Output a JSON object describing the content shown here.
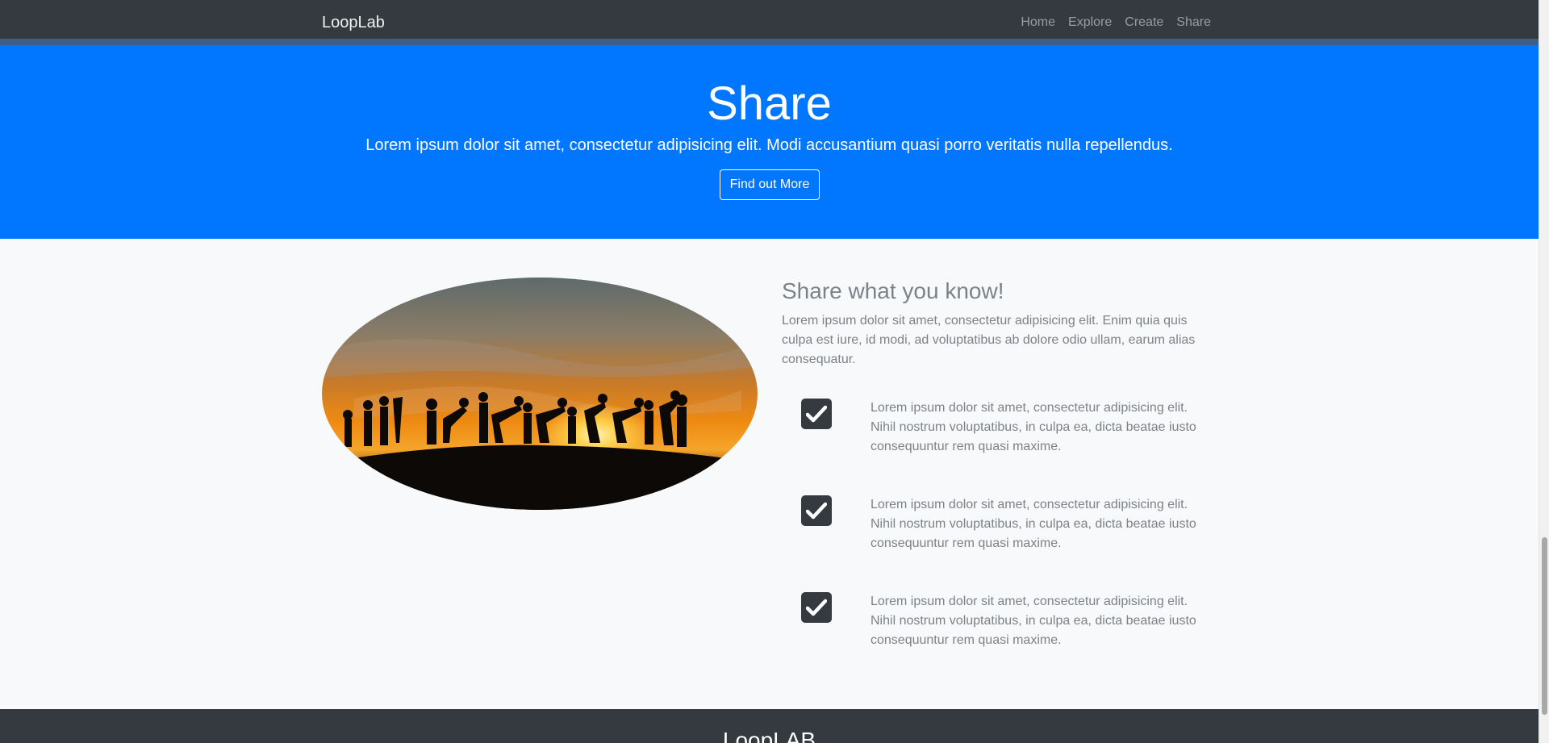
{
  "navbar": {
    "brand": "LoopLab",
    "links": [
      "Home",
      "Explore",
      "Create",
      "Share"
    ]
  },
  "hero": {
    "title": "Share",
    "subtitle": "Lorem ipsum dolor sit amet, consectetur adipisicing elit. Modi accusantium quasi porro veritatis nulla repellendus.",
    "button": "Find out More"
  },
  "section": {
    "title": "Share what you know!",
    "text": "Lorem ipsum dolor sit amet, consectetur adipisicing elit. Enim quia quis culpa est iure, id modi, ad voluptatibus ab dolore odio ullam, earum alias consequatur.",
    "features": [
      {
        "icon": "check-icon",
        "text": "Lorem ipsum dolor sit amet, consectetur adipisicing elit. Nihil nostrum voluptatibus, in culpa ea, dicta beatae iusto consequuntur rem quasi maxime."
      },
      {
        "icon": "check-icon",
        "text": "Lorem ipsum dolor sit amet, consectetur adipisicing elit. Nihil nostrum voluptatibus, in culpa ea, dicta beatae iusto consequuntur rem quasi maxime."
      },
      {
        "icon": "check-icon",
        "text": "Lorem ipsum dolor sit amet, consectetur adipisicing elit. Nihil nostrum voluptatibus, in culpa ea, dicta beatae iusto consequuntur rem quasi maxime."
      }
    ]
  },
  "footer": {
    "title": "LoopLAB"
  },
  "colors": {
    "navbar": "#343a40",
    "hero": "#0177ff",
    "text_muted": "#7c8288",
    "page_bg": "#f8f9fa"
  }
}
